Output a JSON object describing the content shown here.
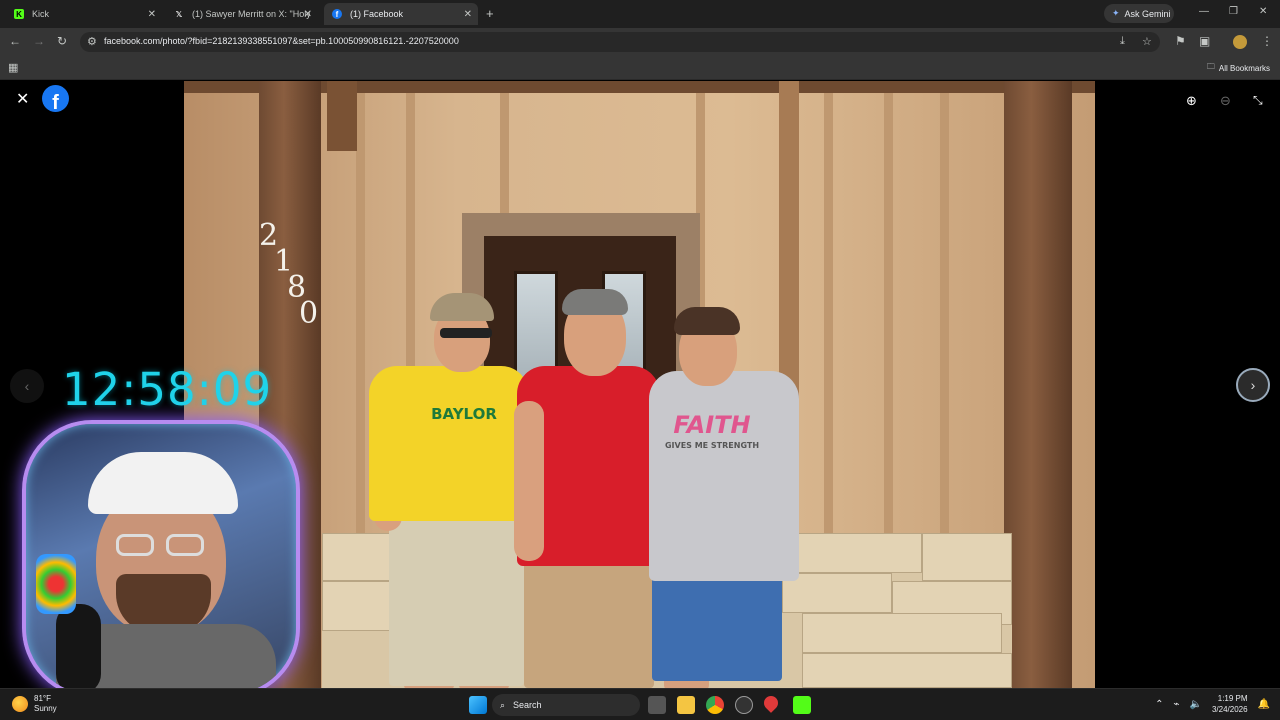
{
  "browser": {
    "tabs": [
      {
        "title": "Kick",
        "favicon": "kick-icon",
        "active": false
      },
      {
        "title": "(1) Sawyer Merritt on X: \"Holy m",
        "favicon": "x-icon",
        "active": false
      },
      {
        "title": "(1) Facebook",
        "favicon": "facebook-icon",
        "active": true
      }
    ],
    "new_tab": "+",
    "ask_gemini": "Ask Gemini",
    "url": "facebook.com/photo/?fbid=2182139338551097&set=pb.100050990816121.-2207520000",
    "all_bookmarks": "All Bookmarks"
  },
  "viewer": {
    "logo": "f",
    "house_number": [
      "2",
      "1",
      "8",
      "0"
    ],
    "shirt_left": "BAYLOR",
    "shirt_right_big": "FAITH",
    "shirt_right_small": "GIVES ME STRENGTH"
  },
  "overlay": {
    "stream_time": "12:58:09"
  },
  "taskbar": {
    "weather_temp": "81°F",
    "weather_desc": "Sunny",
    "search": "Search",
    "time": "1:19 PM",
    "date": "3/24/2026"
  },
  "colors": {
    "facebook_blue": "#1877f2",
    "clock_cyan": "#1fd3ea",
    "webcam_border": "#b78cf0"
  }
}
